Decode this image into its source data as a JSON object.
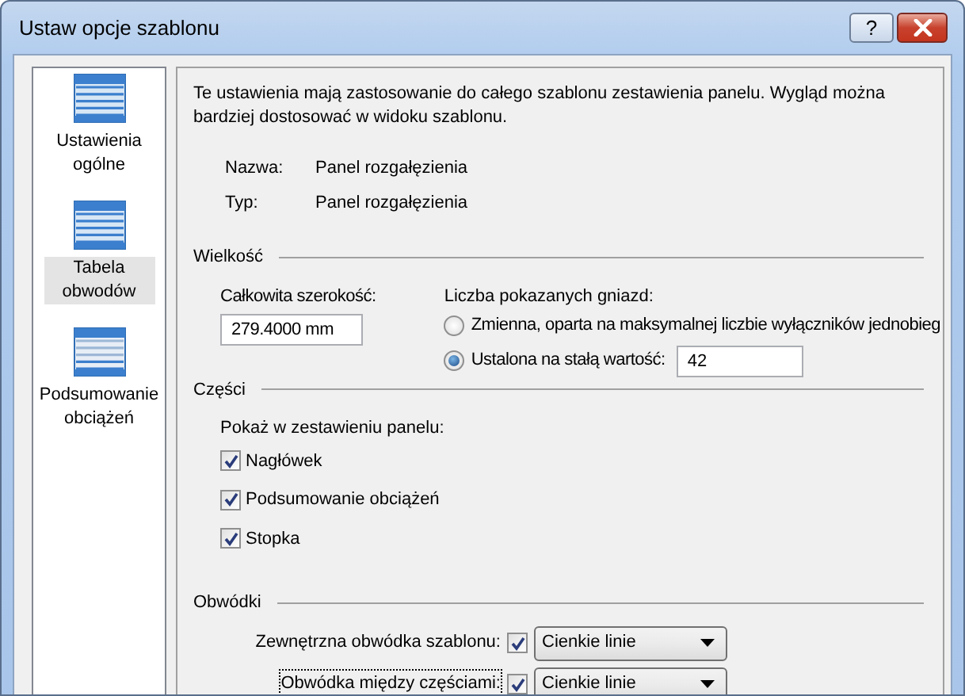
{
  "window": {
    "title": "Ustaw opcje szablonu",
    "help_button": "?"
  },
  "sidebar": {
    "items": [
      {
        "label": "Ustawienia ogólne",
        "selected": false
      },
      {
        "label": "Tabela obwodów",
        "selected": true
      },
      {
        "label": "Podsumowanie obciążeń",
        "selected": false
      }
    ]
  },
  "description": "Te ustawienia mają zastosowanie do całego szablonu zestawienia panelu. Wygląd można bardziej dostosować w widoku szablonu.",
  "properties": [
    {
      "label": "Nazwa:",
      "value": "Panel rozgałęzienia"
    },
    {
      "label": "Typ:",
      "value": "Panel rozgałęzienia"
    }
  ],
  "size": {
    "heading": "Wielkość",
    "width_label": "Całkowita szerokość:",
    "width_value": "279.4000 mm",
    "count_label": "Liczba pokazanych gniazd:",
    "options": [
      {
        "label": "Zmienna, oparta na maksymalnej liczbie wyłączników jednobieg",
        "selected": false
      },
      {
        "label": "Ustalona na stałą wartość:",
        "selected": true,
        "value": "42"
      }
    ]
  },
  "parts": {
    "heading": "Części",
    "label": "Pokaż w zestawieniu panelu:",
    "items": [
      {
        "label": "Nagłówek",
        "checked": true
      },
      {
        "label": "Podsumowanie obciążeń",
        "checked": true
      },
      {
        "label": "Stopka",
        "checked": true
      }
    ]
  },
  "borders": {
    "heading": "Obwódki",
    "rows": [
      {
        "label": "Zewnętrzna obwódka szablonu:",
        "checked": true,
        "value": "Cienkie linie",
        "focused": false
      },
      {
        "label": "Obwódka między częściami:",
        "checked": true,
        "value": "Cienkie linie",
        "focused": true
      }
    ]
  }
}
